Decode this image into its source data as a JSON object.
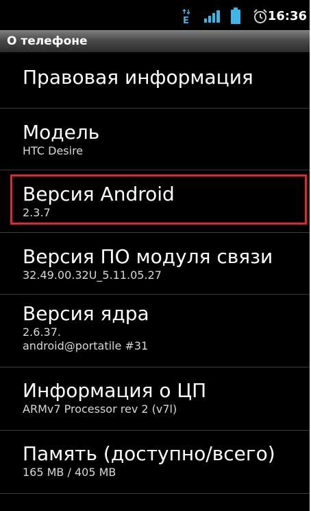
{
  "status_bar": {
    "time": "16:36",
    "network_label": "E",
    "icons": [
      "data-transfer-icon",
      "signal-icon",
      "battery-icon",
      "alarm-clock-icon"
    ],
    "accent": "#3db5e6"
  },
  "title_bar": {
    "title": "О телефоне"
  },
  "rows": [
    {
      "title": "Правовая информация",
      "subtitle": ""
    },
    {
      "title": "Модель",
      "subtitle": "HTC Desire"
    },
    {
      "title": "Версия Android",
      "subtitle": "2.3.7"
    },
    {
      "title": "Версия ПО модуля связи",
      "subtitle": "32.49.00.32U_5.11.05.27"
    },
    {
      "title": "Версия ядра",
      "subtitle": "2.6.37.",
      "subtitle2": "android@portatile #31"
    },
    {
      "title": "Информация о ЦП",
      "subtitle": "ARMv7 Processor rev 2 (v7l)"
    },
    {
      "title": "Память (доступно/всего)",
      "subtitle": "165 MB / 405 MB"
    }
  ],
  "highlight_color": "#e0282e"
}
